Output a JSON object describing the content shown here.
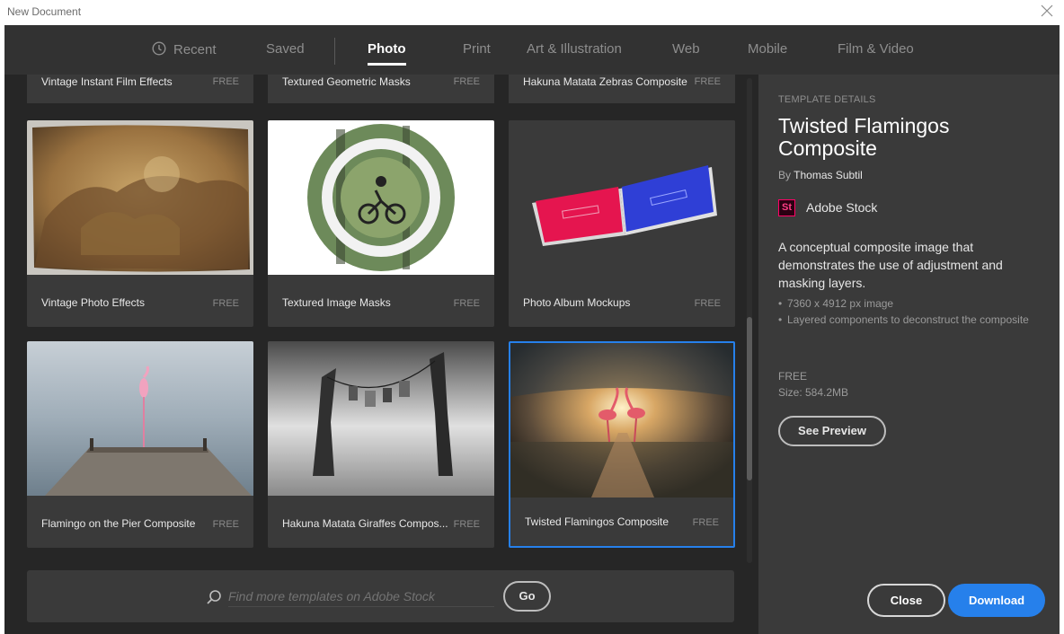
{
  "window": {
    "title": "New Document"
  },
  "tabs": [
    {
      "label": "Recent",
      "active": false
    },
    {
      "label": "Saved",
      "active": false
    },
    {
      "label": "Photo",
      "active": true
    },
    {
      "label": "Print",
      "active": false
    },
    {
      "label": "Art & Illustration",
      "active": false
    },
    {
      "label": "Web",
      "active": false
    },
    {
      "label": "Mobile",
      "active": false
    },
    {
      "label": "Film & Video",
      "active": false
    }
  ],
  "top_row": [
    {
      "label": "Vintage Instant Film Effects",
      "price": "FREE"
    },
    {
      "label": "Textured Geometric Masks",
      "price": "FREE"
    },
    {
      "label": "Hakuna Matata Zebras Composite",
      "price": "FREE"
    }
  ],
  "templates": [
    {
      "label": "Vintage Photo Effects",
      "price": "FREE",
      "selected": false
    },
    {
      "label": "Textured Image Masks",
      "price": "FREE",
      "selected": false
    },
    {
      "label": "Photo Album Mockups",
      "price": "FREE",
      "selected": false
    },
    {
      "label": "Flamingo on the Pier Composite",
      "price": "FREE",
      "selected": false
    },
    {
      "label": "Hakuna Matata Giraffes Compos...",
      "price": "FREE",
      "selected": false
    },
    {
      "label": "Twisted Flamingos Composite",
      "price": "FREE",
      "selected": true
    }
  ],
  "search": {
    "placeholder": "Find more templates on Adobe Stock",
    "go_label": "Go"
  },
  "details": {
    "section_label": "TEMPLATE DETAILS",
    "title": "Twisted Flamingos Composite",
    "author_prefix": "By",
    "author": "Thomas Subtil",
    "badge": "St",
    "source": "Adobe Stock",
    "description": "A conceptual composite image that demonstrates the use of adjustment and masking layers.",
    "bullets": [
      "7360 x 4912 px image",
      "Layered components to deconstruct the composite"
    ],
    "price": "FREE",
    "size": "Size: 584.2MB",
    "preview_label": "See Preview",
    "close_label": "Close",
    "download_label": "Download"
  },
  "colors": {
    "accent": "#2680eb",
    "panel": "#3a3a3a",
    "background": "#262626",
    "stock_badge": "#ff0066"
  },
  "icons": {
    "window_close": "close-icon",
    "recent": "clock-icon",
    "search": "search-icon"
  }
}
